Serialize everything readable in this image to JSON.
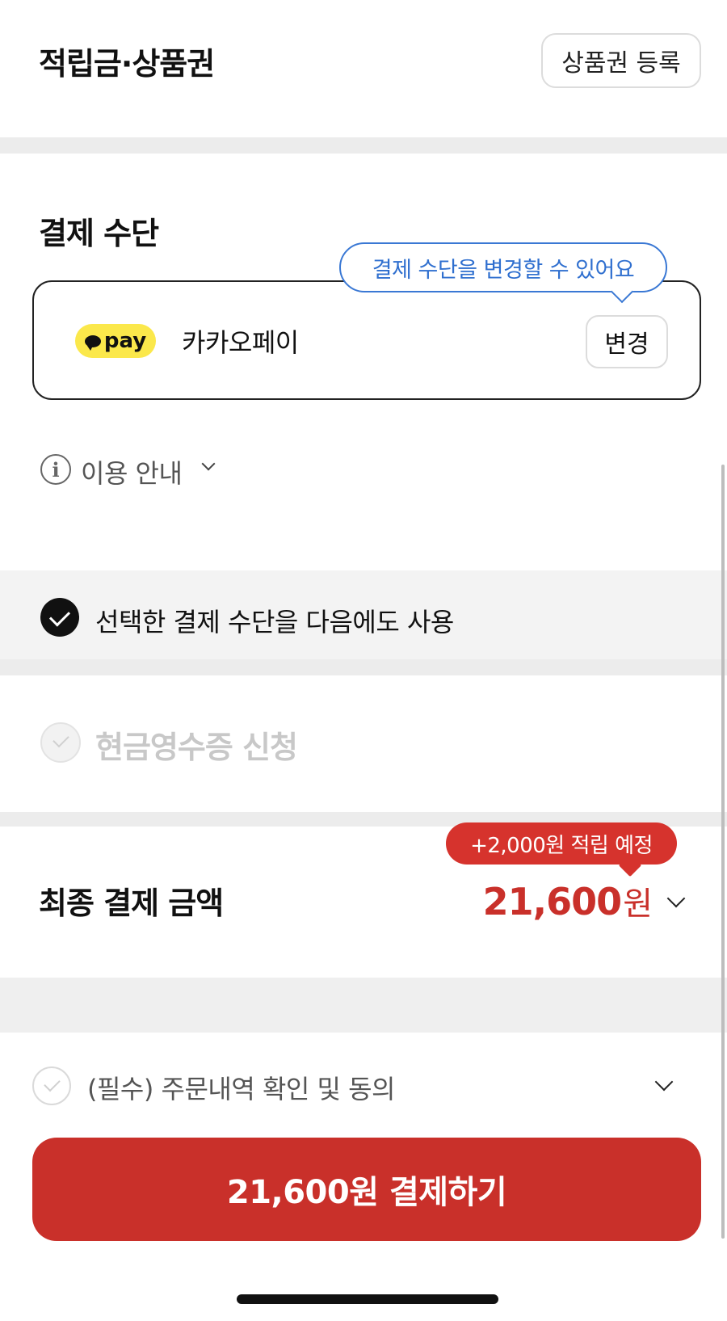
{
  "points_section": {
    "title": "적립금·상품권",
    "register_button": "상품권 등록"
  },
  "payment_method": {
    "title": "결제 수단",
    "tooltip": "결제 수단을 변경할 수 있어요",
    "badge_text": "pay",
    "method_name": "카카오페이",
    "change_button": "변경",
    "info_toggle": "이용 안내",
    "reuse_option": {
      "label": "선택한 결제 수단을 다음에도 사용",
      "checked": true
    }
  },
  "cash_receipt": {
    "label": "현금영수증 신청",
    "checked": false
  },
  "final_payment": {
    "title": "최종 결제 금액",
    "reward_badge": "+2,000원 적립 예정",
    "amount": "21,600",
    "currency_unit": "원"
  },
  "agreement": {
    "label": "(필수) 주문내역 확인 및 동의",
    "checked": false
  },
  "pay_button": {
    "label": "21,600원 결제하기"
  },
  "colors": {
    "accent_red": "#c9302a",
    "tooltip_blue": "#2f6fcf",
    "kakao_yellow": "#fbe84b"
  }
}
